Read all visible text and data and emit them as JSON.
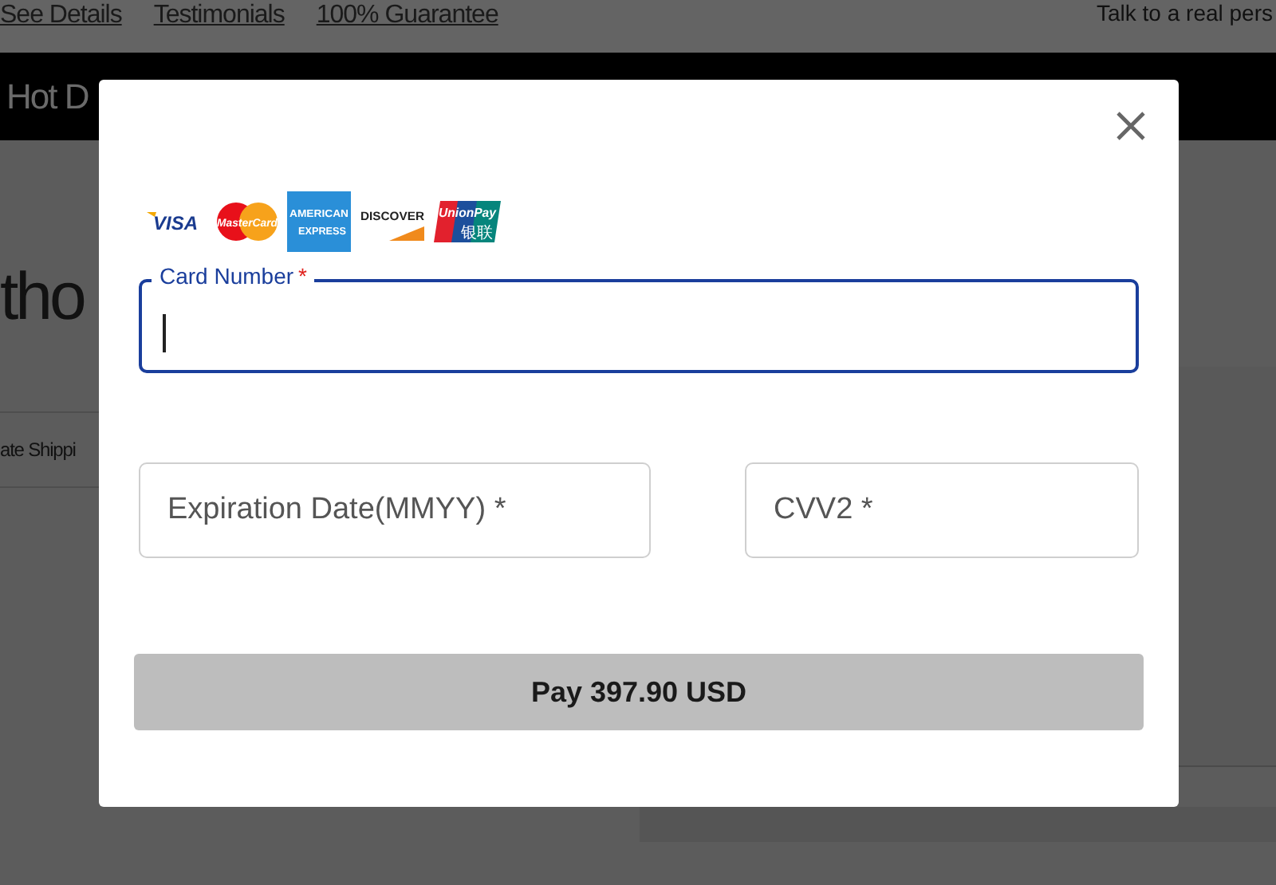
{
  "page_links": [
    "See Details",
    "Testimonials",
    "100% Guarantee"
  ],
  "contact_text": "Talk to a real pers",
  "nav_bar": {
    "text": "Hot D"
  },
  "heading_fragment": "tho",
  "row_fragment": "ate Shippi",
  "payment_dialog": {
    "cards": [
      {
        "kind": "visa",
        "texts": [
          "VISA"
        ]
      },
      {
        "kind": "mastercard",
        "texts": [
          "MasterCard"
        ]
      },
      {
        "kind": "amex",
        "texts": [
          "AMERICAN",
          "EXPRESS"
        ]
      },
      {
        "kind": "discover",
        "texts": [
          "DISCOVER"
        ]
      },
      {
        "kind": "unionpay",
        "texts": [
          "UnionPay",
          "银联"
        ]
      }
    ],
    "fields": [
      {
        "label": "Card Number",
        "mark": "*",
        "focused": true
      },
      {
        "label": "Expiration Date(MMYY)",
        "mark": "*",
        "focused": false
      },
      {
        "label": "CVV2",
        "mark": "*",
        "focused": false
      }
    ],
    "pay_button": "Pay 397.90 USD"
  }
}
